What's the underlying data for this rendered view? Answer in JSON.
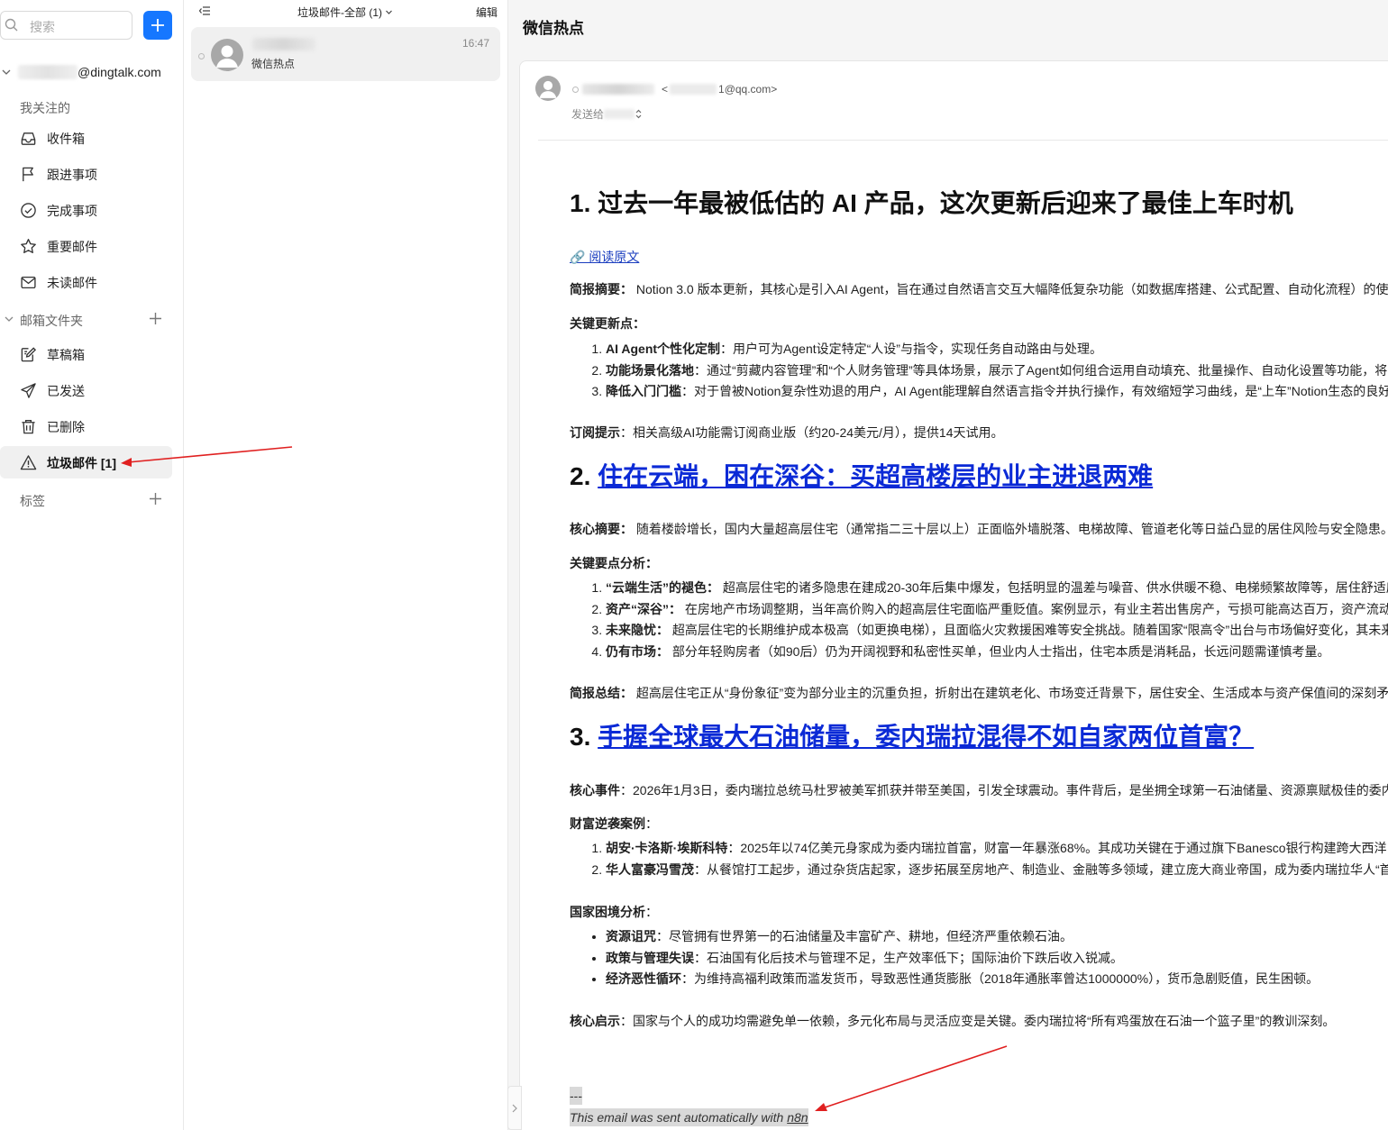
{
  "search": {
    "placeholder": "搜索"
  },
  "account": {
    "email_suffix": "@dingtalk.com"
  },
  "sidebar": {
    "favorites_label": "我关注的",
    "favorites": [
      {
        "label": "收件箱",
        "icon": "inbox-icon"
      },
      {
        "label": "跟进事项",
        "icon": "flag-icon"
      },
      {
        "label": "完成事项",
        "icon": "check-circle-icon"
      },
      {
        "label": "重要邮件",
        "icon": "star-icon"
      },
      {
        "label": "未读邮件",
        "icon": "envelope-icon"
      }
    ],
    "folders_label": "邮箱文件夹",
    "folders": [
      {
        "label": "草稿箱",
        "icon": "draft-icon"
      },
      {
        "label": "已发送",
        "icon": "send-icon"
      },
      {
        "label": "已删除",
        "icon": "trash-icon"
      },
      {
        "label": "垃圾邮件 [1]",
        "icon": "warning-icon"
      }
    ],
    "tags_label": "标签"
  },
  "mail_list": {
    "title": "垃圾邮件-全部 (1)",
    "edit_label": "编辑",
    "items": [
      {
        "subject": "微信热点",
        "time": "16:47"
      }
    ]
  },
  "reader": {
    "title": "微信热点",
    "from_email_tail": "1@qq.com>",
    "from_email_head": "<",
    "to_label": "发送给",
    "colors": {
      "accent": "#1677ff",
      "heading_link": "#0b2ad6",
      "annotation": "#e02020"
    },
    "body": {
      "s1": {
        "title": "1. 过去一年最被低估的 AI 产品，这次更新后迎来了最佳上车时机",
        "read_original": "🔗 阅读原文",
        "summary_label": "简报摘要：",
        "summary": " Notion 3.0 版本更新，其核心是引入AI Agent，旨在通过自然语言交互大幅降低复杂功能（如数据库搭建、公式配置、自动化流程）的使",
        "points_label": "关键更新点：",
        "points": [
          {
            "b": "AI Agent个性化定制",
            "t": "：用户可为Agent设定特定“人设”与指令，实现任务自动路由与处理。"
          },
          {
            "b": "功能场景化落地",
            "t": "：通过“剪藏内容管理”和“个人财务管理”等具体场景，展示了Agent如何组合运用自动填充、批量操作、自动化设置等功能，将"
          },
          {
            "b": "降低入门门槛",
            "t": "：对于曾被Notion复杂性劝退的用户，AI Agent能理解自然语言指令并执行操作，有效缩短学习曲线，是“上车”Notion生态的良好"
          }
        ],
        "tip_label": "订阅提示",
        "tip": "：相关高级AI功能需订阅商业版（约20-24美元/月），提供14天试用。"
      },
      "s2": {
        "num": "2. ",
        "title": "住在云端，困在深谷：买超高楼层的业主进退两难",
        "summary_label": "核心摘要：",
        "summary": " 随着楼龄增长，国内大量超高层住宅（通常指二三十层以上）正面临外墙脱落、电梯故障、管道老化等日益凸显的居住风险与安全隐患。",
        "points_label": "关键要点分析：",
        "points": [
          {
            "b": "“云端生活”的褪色：",
            "t": " 超高层住宅的诸多隐患在建成20-30年后集中爆发，包括明显的温差与噪音、供水供暖不稳、电梯频繁故障等，居住舒适度"
          },
          {
            "b": "资产“深谷”：",
            "t": " 在房地产市场调整期，当年高价购入的超高层住宅面临严重贬值。案例显示，有业主若出售房产，亏损可能高达百万，资产流动"
          },
          {
            "b": "未来隐忧：",
            "t": " 超高层住宅的长期维护成本极高（如更换电梯），且面临火灾救援困难等安全挑战。随着国家“限高令”出台与市场偏好变化，其未来"
          },
          {
            "b": "仍有市场：",
            "t": " 部分年轻购房者（如90后）仍为开阔视野和私密性买单，但业内人士指出，住宅本质是消耗品，长远问题需谨慎考量。"
          }
        ],
        "conclusion_label": "简报总结：",
        "conclusion": " 超高层住宅正从“身份象征”变为部分业主的沉重负担，折射出在建筑老化、市场变迁背景下，居住安全、生活成本与资产保值间的深刻矛"
      },
      "s3": {
        "num": "3. ",
        "title": "手握全球最大石油储量，委内瑞拉混得不如自家两位首富？",
        "event_label": "核心事件",
        "event": "：2026年1月3日，委内瑞拉总统马杜罗被美军抓获并带至美国，引发全球震动。事件背后，是坐拥全球第一石油储量、资源禀赋极佳的委内",
        "cases_label": "财富逆袭案例",
        "cases_colon": "：",
        "cases": [
          {
            "b": "胡安·卡洛斯·埃斯科特",
            "t": "：2025年以74亿美元身家成为委内瑞拉首富，财富一年暴涨68%。其成功关键在于通过旗下Banesco银行构建跨大西洋"
          },
          {
            "b": "华人富豪冯雪茂",
            "t": "：从餐馆打工起步，通过杂货店起家，逐步拓展至房地产、制造业、金融等多领域，建立庞大商业帝国，成为委内瑞拉华人“首"
          }
        ],
        "nation_label": "国家困境分析",
        "nation_colon": "：",
        "nation": [
          {
            "b": "资源诅咒",
            "t": "：尽管拥有世界第一的石油储量及丰富矿产、耕地，但经济严重依赖石油。"
          },
          {
            "b": "政策与管理失误",
            "t": "：石油国有化后技术与管理不足，生产效率低下；国际油价下跌后收入锐减。"
          },
          {
            "b": "经济恶性循环",
            "t": "：为维持高福利政策而滥发货币，导致恶性通货膨胀（2018年通胀率曾达1000000%），货币急剧贬值，民生困顿。"
          }
        ],
        "insight_label": "核心启示",
        "insight": "：国家与个人的成功均需避免单一依赖，多元化布局与灵活应变是关键。委内瑞拉将“所有鸡蛋放在石油一个篮子里”的教训深刻。"
      },
      "signature_sep": "---",
      "signature_text": "This email was sent automatically with ",
      "signature_link": "n8n"
    }
  }
}
